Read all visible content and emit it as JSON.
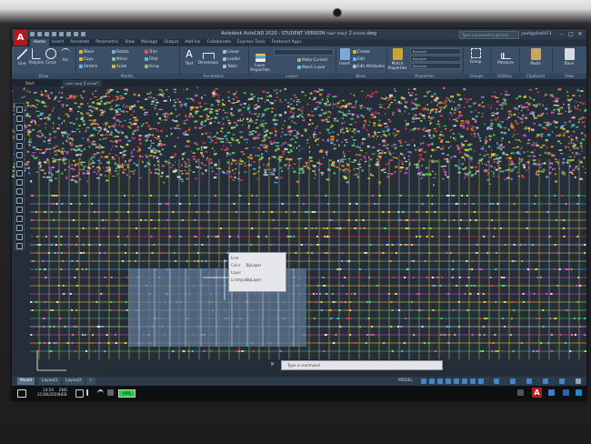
{
  "app": {
    "logo_letter": "A",
    "window_title": "Autodesk AutoCAD 2020 - STUDENT VERSION   תוכנית 2 קומה ישנה.dwg",
    "search_placeholder": "Type a keyword or phrase",
    "user_name": "yaeltgalla6973",
    "window_controls": [
      "–",
      "□",
      "✕"
    ]
  },
  "ribbon_tabs": [
    {
      "label": "Home",
      "active": true
    },
    {
      "label": "Insert"
    },
    {
      "label": "Annotate"
    },
    {
      "label": "Parametric"
    },
    {
      "label": "View"
    },
    {
      "label": "Manage"
    },
    {
      "label": "Output"
    },
    {
      "label": "Add-ins"
    },
    {
      "label": "Collaborate"
    },
    {
      "label": "Express Tools"
    },
    {
      "label": "Featured Apps"
    }
  ],
  "ribbon": {
    "draw": {
      "title": "Draw",
      "line": "Line",
      "polyline": "Polyline",
      "circle": "Circle",
      "arc": "Arc"
    },
    "modify": {
      "title": "Modify",
      "move": "Move",
      "rotate": "Rotate",
      "trim": "Trim",
      "copy": "Copy",
      "mirror": "Mirror",
      "fillet": "Fillet",
      "stretch": "Stretch",
      "scale": "Scale",
      "array": "Array"
    },
    "annotation": {
      "title": "Annotation",
      "text": "Text",
      "dimension": "Dimension",
      "linear": "Linear",
      "leader": "Leader",
      "table": "Table"
    },
    "layers": {
      "title": "Layers",
      "layer_properties": "Layer Properties",
      "make_current": "Make Current",
      "match_layer": "Match Layer"
    },
    "block": {
      "title": "Block",
      "insert": "Insert",
      "create": "Create",
      "edit": "Edit",
      "edit_attributes": "Edit Attributes"
    },
    "properties": {
      "title": "Properties",
      "match_properties": "Match Properties",
      "bylayer_1": "ByLayer",
      "bylayer_2": "ByLayer",
      "bylayer_3": "ByLayer"
    },
    "groups": {
      "title": "Groups",
      "group": "Group"
    },
    "utilities": {
      "title": "Utilities",
      "measure": "Measure"
    },
    "clipboard": {
      "title": "Clipboard",
      "paste": "Paste"
    },
    "view": {
      "title": "View",
      "base": "Base"
    }
  },
  "file_tabs": [
    {
      "label": "Start"
    },
    {
      "label": "תוכנית 2 קומה ישנה*",
      "active": true
    }
  ],
  "tooltip": {
    "color_key": "Color",
    "color_val": "ByLayer",
    "layer_key": "Layer",
    "layer_val": "",
    "title_key": "Linetype",
    "linetype_val": "ByLayer",
    "header": "Line"
  },
  "command_line": {
    "placeholder": "Type a command"
  },
  "status_bar": {
    "layout_tabs": [
      {
        "label": "Model",
        "active": true
      },
      {
        "label": "Layout1"
      },
      {
        "label": "Layout2"
      }
    ],
    "add_tab": "+",
    "mode": "MODEL"
  },
  "taskbar": {
    "time": "14:54",
    "date": "21/08/2020",
    "lang_top": "ENG",
    "lang_bottom": "HEB",
    "battery": "99%"
  }
}
